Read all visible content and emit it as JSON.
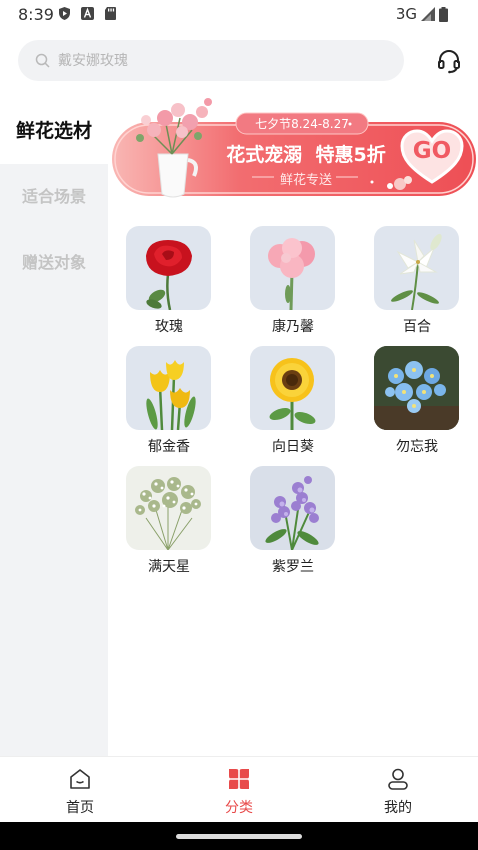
{
  "status_bar": {
    "time": "8:39",
    "network": "3G"
  },
  "search": {
    "placeholder": "戴安娜玫瑰"
  },
  "sidebar": {
    "items": [
      {
        "label": "鲜花选材",
        "active": true
      },
      {
        "label": "适合场景",
        "active": false
      },
      {
        "label": "赠送对象",
        "active": false
      }
    ]
  },
  "banner": {
    "tag": "七夕节8.24-8.27",
    "headline": "花式宠溺  特惠5折",
    "sub": "鲜花专送",
    "go": "GO"
  },
  "flowers": [
    {
      "name": "玫瑰"
    },
    {
      "name": "康乃馨"
    },
    {
      "name": "百合"
    },
    {
      "name": "郁金香"
    },
    {
      "name": "向日葵"
    },
    {
      "name": "勿忘我"
    },
    {
      "name": "满天星"
    },
    {
      "name": "紫罗兰"
    }
  ],
  "tabbar": {
    "tabs": [
      {
        "label": "首页",
        "icon": "home-icon",
        "active": false
      },
      {
        "label": "分类",
        "icon": "category-icon",
        "active": true
      },
      {
        "label": "我的",
        "icon": "profile-icon",
        "active": false
      }
    ]
  },
  "colors": {
    "accent": "#e84a4a",
    "sidebar_bg": "#f2f3f5",
    "banner_red": "#f05a5f"
  }
}
